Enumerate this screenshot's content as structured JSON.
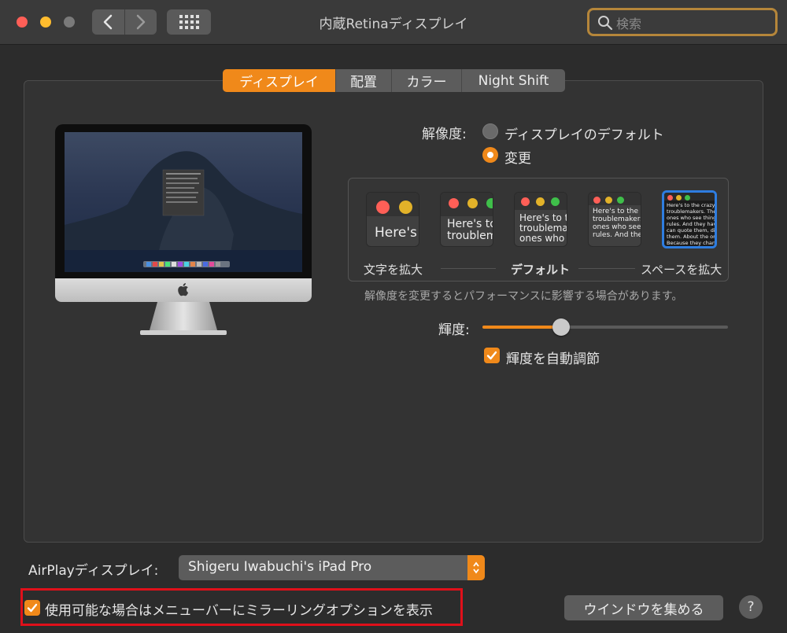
{
  "window": {
    "title": "内蔵Retinaディスプレイ",
    "search_placeholder": "検索",
    "traffic_light_colors": [
      "#ff5f57",
      "#febc2e",
      "#7a7a7a"
    ]
  },
  "tabs": [
    {
      "label": "ディスプレイ",
      "active": true
    },
    {
      "label": "配置",
      "active": false
    },
    {
      "label": "カラー",
      "active": false
    },
    {
      "label": "Night Shift",
      "active": false
    }
  ],
  "resolution": {
    "label": "解像度:",
    "options": [
      {
        "label": "ディスプレイのデフォルト",
        "selected": false
      },
      {
        "label": "変更",
        "selected": true
      }
    ],
    "scale_thumbnails": [
      "Here's",
      "Here's to\ntroublem",
      "Here's to t\ntroublema\nones who",
      "Here's to the cr\ntroublemakers.\nones who see t\nrules. And they",
      "Here's to the crazy one\ntroublemakers. The rou\nones who see things dif\nrules. And they have no\ncan quote them, disagr\nthem. About the only th\nBecause they change th"
    ],
    "scale_labels": {
      "left": "文字を拡大",
      "center": "デフォルト",
      "right": "スペースを拡大"
    },
    "selected_scale_index": 4,
    "note": "解像度を変更するとパフォーマンスに影響する場合があります。"
  },
  "brightness": {
    "label": "輝度:",
    "level": 0.32,
    "auto_label": "輝度を自動調節",
    "auto_checked": true
  },
  "airplay": {
    "label": "AirPlayディスプレイ:",
    "value": "Shigeru Iwabuchi's iPad Pro"
  },
  "mirror_option": {
    "label": "使用可能な場合はメニューバーにミラーリングオプションを表示",
    "checked": true
  },
  "buttons": {
    "gather_windows": "ウインドウを集める",
    "help": "?"
  },
  "colors": {
    "accent": "#f0891a",
    "highlight_box": "#e0101a",
    "selected_thumbnail_border": "#2e7de0"
  }
}
